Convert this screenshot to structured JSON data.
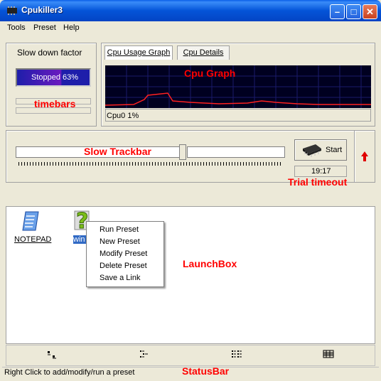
{
  "window": {
    "title": "Cpukiller3",
    "minimize": "–",
    "maximize": "□",
    "close": "✕"
  },
  "menu": [
    "Tools",
    "Preset",
    "Help"
  ],
  "slowdown": {
    "label": "Slow down factor",
    "progress_text": "Stopped 63%",
    "progress_value": 0.63
  },
  "annotations": {
    "timebars": "timebars",
    "cpu_graph": "Cpu Graph",
    "slow_trackbar": "Slow Trackbar",
    "trial_timeout": "Trial timeout",
    "launchbox": "LaunchBox",
    "statusbar": "StatusBar"
  },
  "tabs": [
    {
      "label": "Cpu Usage Graph"
    },
    {
      "label": "Cpu Details"
    }
  ],
  "cpu": {
    "status": "Cpu0 1%"
  },
  "trackbar": {
    "value": 0.62
  },
  "start": {
    "label": "Start"
  },
  "timer": "19:17",
  "launch": {
    "items": [
      {
        "label": "NOTEPAD"
      },
      {
        "label": "win"
      }
    ],
    "context_menu": [
      "Run Preset",
      "New Preset",
      "Modify Preset",
      "Delete Preset",
      "Save a Link"
    ]
  },
  "status": "Right Click to add/modify/run a preset",
  "colors": {
    "accent_red": "#ff0000",
    "graph_bg": "#000020",
    "graph_line": "#ff2020",
    "selection": "#316ac5"
  }
}
